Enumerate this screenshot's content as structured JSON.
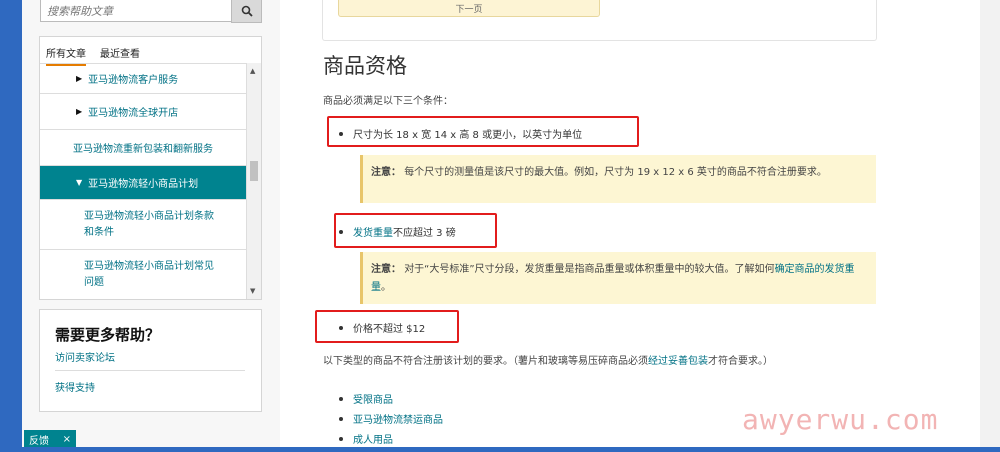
{
  "search": {
    "placeholder": "搜索帮助文章"
  },
  "nav": {
    "tab_all": "所有文章",
    "tab_recent": "最近查看",
    "items": [
      {
        "label": "亚马逊物流客户服务"
      },
      {
        "label": "亚马逊物流全球开店"
      },
      {
        "label": "亚马逊物流重新包装和翻新服务"
      },
      {
        "label": "亚马逊物流轻小商品计划"
      },
      {
        "label": "亚马逊物流轻小商品计划条款和条件"
      },
      {
        "label": "亚马逊物流轻小商品计划常见问题"
      }
    ]
  },
  "help": {
    "title": "需要更多帮助？",
    "link_forum": "访问卖家论坛",
    "link_support": "获得支持"
  },
  "feedback": {
    "label": "反馈",
    "close": "×"
  },
  "main": {
    "prev_label": "下一页",
    "heading": "商品资格",
    "intro": "商品必须满足以下三个条件：",
    "bullet1": "尺寸为长 18 x 宽 14 x 高 8 或更小，以英寸为单位",
    "note1": {
      "label": "注意：",
      "text": "每个尺寸的测量值是该尺寸的最大值。例如，尺寸为 19 x 12 x 6 英寸的商品不符合注册要求。"
    },
    "bullet2_link": "发货重量",
    "bullet2_rest": "不应超过 3 磅",
    "note2": {
      "label": "注意：",
      "text": "对于“大号标准”尺寸分段，发货重量是指商品重量或体积重量中的较大值。了解如何",
      "link": "确定商品的发货重量",
      "end": "。"
    },
    "bullet3": "价格不超过 $12",
    "after": {
      "text": "以下类型的商品不符合注册该计划的要求。（薯片和玻璃等易压碎商品必须",
      "link": "经过妥善包装",
      "end": "才符合要求。）"
    },
    "list": [
      {
        "label": "受限商品"
      },
      {
        "label": "亚马逊物流禁运商品"
      },
      {
        "label": "成人用品"
      }
    ]
  },
  "watermark": "awyerwu.com"
}
